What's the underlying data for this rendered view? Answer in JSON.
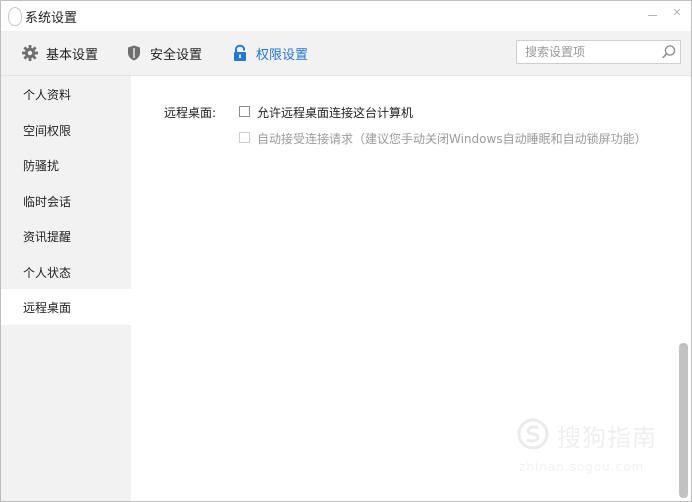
{
  "window": {
    "title": "系统设置",
    "minimize_glyph": "—",
    "close_glyph": "✕"
  },
  "toolbar": {
    "tabs": [
      {
        "label": "基本设置",
        "icon": "gear-icon"
      },
      {
        "label": "安全设置",
        "icon": "shield-icon"
      },
      {
        "label": "权限设置",
        "icon": "lock-icon",
        "active": true
      }
    ],
    "search": {
      "placeholder": "搜索设置项",
      "value": ""
    }
  },
  "sidebar": {
    "items": [
      {
        "label": "个人资料"
      },
      {
        "label": "空间权限"
      },
      {
        "label": "防骚扰"
      },
      {
        "label": "临时会话"
      },
      {
        "label": "资讯提醒"
      },
      {
        "label": "个人状态"
      },
      {
        "label": "远程桌面",
        "active": true
      }
    ]
  },
  "content": {
    "section_label": "远程桌面:",
    "options": [
      {
        "label": "允许远程桌面连接这台计算机",
        "checked": false,
        "enabled": true
      },
      {
        "label": "自动接受连接请求（建议您手动关闭Windows自动睡眠和自动锁屏功能）",
        "checked": false,
        "enabled": false
      }
    ]
  },
  "watermark": {
    "title": "搜狗指南",
    "url": "zhinan.sogou.com"
  },
  "colors": {
    "accent": "#2577d6",
    "sidebar_bg": "#f2f2f2",
    "toolbar_bg": "#f2f2f2",
    "disabled_text": "#9b9b9b"
  }
}
